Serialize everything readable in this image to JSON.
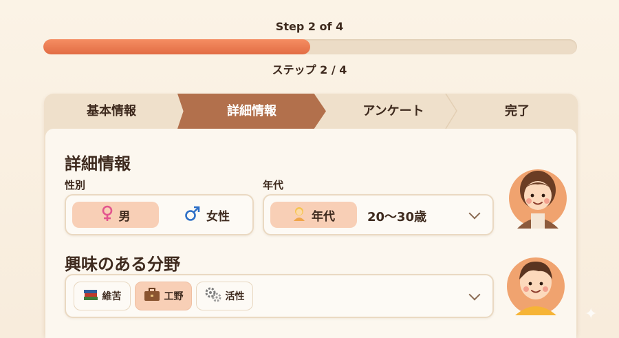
{
  "progress": {
    "step_label_en": "Step 2 of 4",
    "step_label_jp": "ステップ 2 / 4",
    "fraction": 0.5,
    "fill_color": "#e97a50",
    "track_color": "#ecdcc6"
  },
  "tabs": [
    {
      "label": "基本情報",
      "state": "done"
    },
    {
      "label": "詳細情報",
      "state": "active"
    },
    {
      "label": "アンケート",
      "state": "pending"
    },
    {
      "label": "完了",
      "state": "pending"
    }
  ],
  "section_title": "詳細情報",
  "gender": {
    "label": "性別",
    "options": [
      {
        "icon": "female-sign-icon",
        "label": "男",
        "selected": true
      },
      {
        "icon": "male-sign-icon",
        "label": "女性",
        "selected": false
      }
    ]
  },
  "age": {
    "label": "年代",
    "chip_label": "年代",
    "chip_icon": "person-icon",
    "value": "20〜30歳"
  },
  "interests": {
    "title": "興味のある分野",
    "chips": [
      {
        "icon": "books-icon",
        "label": "維苦",
        "selected": false
      },
      {
        "icon": "briefcase-icon",
        "label": "工野",
        "selected": true
      },
      {
        "icon": "gears-icon",
        "label": "活性",
        "selected": false
      }
    ]
  },
  "colors": {
    "accent": "#e97a50",
    "active_tab": "#b2704c",
    "selected_chip": "#f8cfb6"
  }
}
